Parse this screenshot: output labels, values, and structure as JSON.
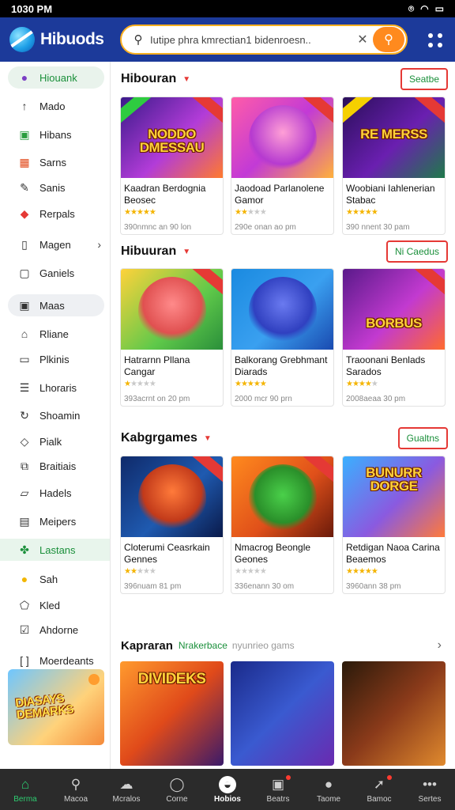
{
  "status": {
    "time": "1030 PM"
  },
  "header": {
    "app_name": "Hibuods",
    "search_placeholder": "Iutipe phra kmrectian1 bidenroesn..",
    "search_value": "Iutipe phra kmrectian1 bidenroesn.."
  },
  "sidebar": {
    "items": [
      {
        "label": "Hiouank",
        "icon": "globe-icon"
      },
      {
        "label": "Mado",
        "icon": "arrow-up-icon"
      },
      {
        "label": "Hibans",
        "icon": "gift-icon"
      },
      {
        "label": "Sarns",
        "icon": "grid-icon"
      },
      {
        "label": "Sanis",
        "icon": "puzzle-icon"
      },
      {
        "label": "Rerpals",
        "icon": "gem-icon"
      },
      {
        "label": "Magen",
        "icon": "book-icon"
      },
      {
        "label": "Ganiels",
        "icon": "square-icon"
      },
      {
        "label": "Maas",
        "icon": "chat-icon"
      },
      {
        "label": "Rliane",
        "icon": "home-icon"
      },
      {
        "label": "Plkinis",
        "icon": "document-icon"
      },
      {
        "label": "Lhoraris",
        "icon": "list-icon"
      },
      {
        "label": "Shoamin",
        "icon": "refresh-icon"
      },
      {
        "label": "Pialk",
        "icon": "leaf-icon"
      },
      {
        "label": "Braitiais",
        "icon": "copy-icon"
      },
      {
        "label": "Hadels",
        "icon": "folder-icon"
      },
      {
        "label": "Meipers",
        "icon": "calendar-icon"
      },
      {
        "label": "Lastans",
        "icon": "clover-icon"
      },
      {
        "label": "Sah",
        "icon": "coin-icon"
      },
      {
        "label": "Kled",
        "icon": "shield-icon"
      },
      {
        "label": "Ahdorne",
        "icon": "check-icon"
      },
      {
        "label": "Moerdeants",
        "icon": "bracket-icon"
      }
    ],
    "promo_text": "DIASAYS DEMARKS"
  },
  "sections": [
    {
      "title": "Hibouran",
      "button": "Seatbe",
      "cards": [
        {
          "art": "NODDO DMESSAU",
          "title": "Kaadran Berdognia Beosec",
          "rating": 5,
          "meta": "390nmnc an 90 lon"
        },
        {
          "art": "",
          "title": "Jaodoad Parlanolene Gamor",
          "rating": 2,
          "meta": "290e onan ao pm"
        },
        {
          "art": "RE MERSS",
          "title": "Woobiani Iahlenerian Stabac",
          "rating": 5,
          "meta": "390 nnent 30 pam"
        }
      ]
    },
    {
      "title": "Hibuuran",
      "button": "Ni Caedus",
      "cards": [
        {
          "art": "",
          "title": "Hatrarnn Pllana Cangar",
          "rating": 1,
          "meta": "393acrnt on 20 pm"
        },
        {
          "art": "",
          "title": "Balkorang Grebhmant Diarads",
          "rating": 5,
          "meta": "2000 mcr 90 prn"
        },
        {
          "art": "BORBUS",
          "title": "Traoonani Benlads Sarados",
          "rating": 4,
          "meta": "2008aeaa 30 pm"
        }
      ]
    },
    {
      "title": "Kabgrgames",
      "button": "Gualtns",
      "cards": [
        {
          "art": "",
          "title": "Cloterumi Ceasrkain Gennes",
          "rating": 2,
          "meta": "396nuam 81 pm"
        },
        {
          "art": "",
          "title": "Nmacrog Beongle Geones",
          "rating": 0,
          "meta": "336enann 30 om"
        },
        {
          "art": "BUNURR DORGE",
          "title": "Retdigan Naoa Carina Beaemos",
          "rating": 5,
          "meta": "3960ann 38 pm"
        }
      ]
    }
  ],
  "more": {
    "title": "Kapraran",
    "tag": "Nrakerbace",
    "subtitle": "nyunrieo gams"
  },
  "bottom_cards": [
    {
      "art": "DIVIDEKS"
    },
    {
      "art": ""
    },
    {
      "art": ""
    }
  ],
  "bottom_nav": [
    {
      "label": "Berma",
      "icon": "home-icon"
    },
    {
      "label": "Macoa",
      "icon": "search-icon"
    },
    {
      "label": "Mcralos",
      "icon": "gamepad-icon"
    },
    {
      "label": "Corne",
      "icon": "circle-icon"
    },
    {
      "label": "Hobios",
      "icon": "controller-icon"
    },
    {
      "label": "Beatrs",
      "icon": "calendar-icon"
    },
    {
      "label": "Taome",
      "icon": "user-icon"
    },
    {
      "label": "Bamoc",
      "icon": "rocket-icon"
    },
    {
      "label": "Sertes",
      "icon": "more-icon"
    }
  ],
  "colors": {
    "header": "#1c3a9a",
    "accent_green": "#1a8f3a",
    "accent_red": "#e53935",
    "nav_bg": "#2b2b2b"
  }
}
